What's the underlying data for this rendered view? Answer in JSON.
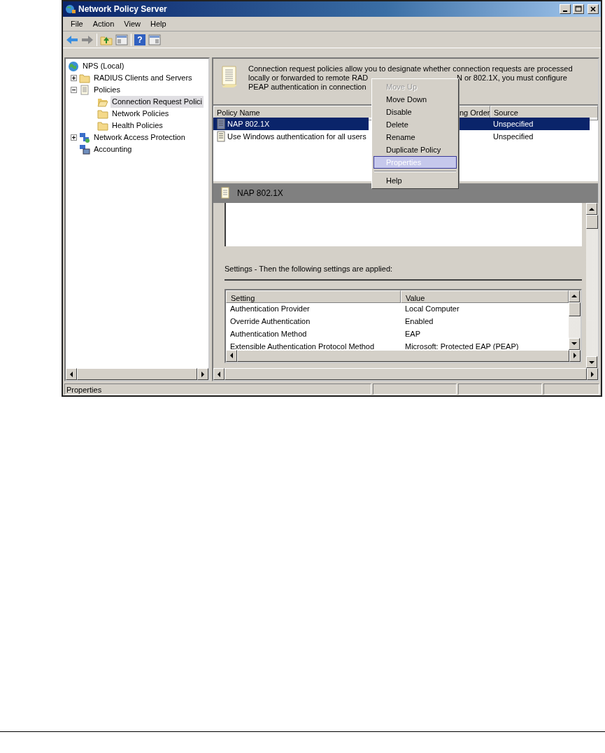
{
  "window": {
    "title": "Network Policy Server"
  },
  "menu_bar": [
    "File",
    "Action",
    "View",
    "Help"
  ],
  "toolbar_help_glyph": "?",
  "tree": [
    {
      "label": "NPS (Local)",
      "kind": "globe",
      "selected": false,
      "children": [
        {
          "label": "RADIUS Clients and Servers",
          "kind": "folder",
          "expanded": false,
          "selected": false
        },
        {
          "label": "Policies",
          "kind": "scroll",
          "expanded": true,
          "selected": false,
          "children": [
            {
              "label": "Connection Request Polici",
              "kind": "open-folder",
              "selected": true
            },
            {
              "label": "Network Policies",
              "kind": "folder",
              "selected": false
            },
            {
              "label": "Health Policies",
              "kind": "folder",
              "selected": false
            }
          ]
        },
        {
          "label": "Network Access Protection",
          "kind": "network",
          "expanded": false,
          "selected": false
        },
        {
          "label": "Accounting",
          "kind": "computer",
          "selected": false
        }
      ]
    }
  ],
  "description": [
    [
      "Connection request policies allow you to designate whether connection requests are processed"
    ],
    [
      "locally or forwarded to remote RAD",
      "N or 802.1X, you must configure"
    ],
    [
      "PEAP authentication in connection"
    ]
  ],
  "policy_table": {
    "columns": [
      "Policy Name",
      "ng Order",
      "Source"
    ],
    "rows": [
      {
        "name": "NAP 802.1X",
        "source": "Unspecified",
        "selected": true
      },
      {
        "name": "Use Windows authentication for all users",
        "source": "Unspecified",
        "selected": false
      }
    ]
  },
  "context_menu": [
    {
      "label": "Move Up",
      "disabled": true,
      "selected": false
    },
    {
      "label": "Move Down",
      "disabled": false,
      "selected": false
    },
    {
      "label": "Disable",
      "disabled": false,
      "selected": false
    },
    {
      "label": "Delete",
      "disabled": false,
      "selected": false
    },
    {
      "label": "Rename",
      "disabled": false,
      "selected": false
    },
    {
      "label": "Duplicate Policy",
      "disabled": false,
      "selected": false
    },
    {
      "label": "Properties",
      "disabled": false,
      "selected": true
    },
    {
      "label": "Help",
      "disabled": false,
      "selected": false,
      "separator_before": true
    }
  ],
  "detail": {
    "title": "NAP 802.1X",
    "settings_label": "Settings - Then the following settings are applied:",
    "columns": [
      "Setting",
      "Value"
    ],
    "rows": [
      [
        "Authentication Provider",
        "Local Computer"
      ],
      [
        "Override Authentication",
        "Enabled"
      ],
      [
        "Authentication Method",
        "EAP"
      ],
      [
        "Extensible Authentication Protocol Method",
        "Microsoft: Protected EAP (PEAP)"
      ]
    ]
  },
  "status_bar": "Properties"
}
